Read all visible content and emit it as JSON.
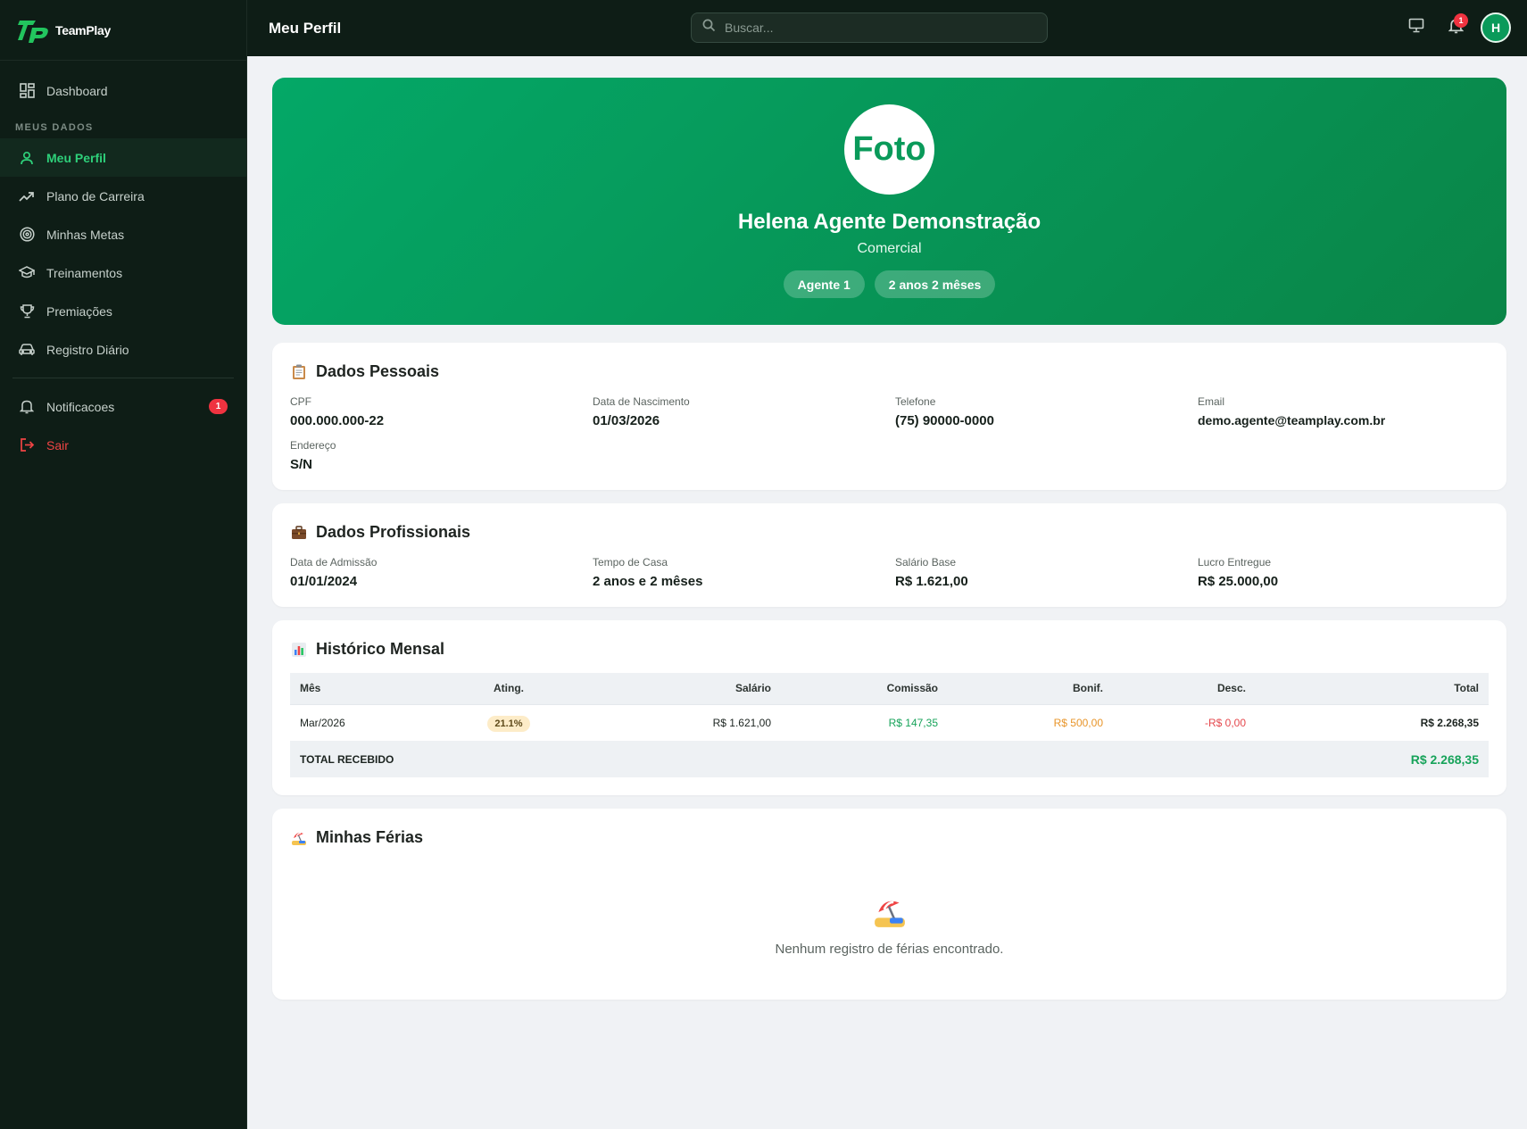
{
  "brand": {
    "name": "TeamPlay"
  },
  "sidebar": {
    "dashboard": "Dashboard",
    "section_label": "MEUS DADOS",
    "items": [
      {
        "label": "Meu Perfil",
        "icon": "user-icon",
        "active": true
      },
      {
        "label": "Plano de Carreira",
        "icon": "trending-up-icon"
      },
      {
        "label": "Minhas Metas",
        "icon": "target-icon"
      },
      {
        "label": "Treinamentos",
        "icon": "graduation-cap-icon"
      },
      {
        "label": "Premiações",
        "icon": "trophy-icon"
      },
      {
        "label": "Registro Diário",
        "icon": "car-icon"
      }
    ],
    "notifications": {
      "label": "Notificacoes",
      "badge": "1"
    },
    "logout": "Sair"
  },
  "topbar": {
    "title": "Meu Perfil",
    "search_placeholder": "Buscar...",
    "bell_badge": "1",
    "avatar_initial": "H"
  },
  "profile": {
    "photo_text": "Foto",
    "name": "Helena Agente Demonstração",
    "role": "Comercial",
    "level": "Agente 1",
    "tenure": "2 anos 2 mêses"
  },
  "personal": {
    "title": "Dados Pessoais",
    "cpf_label": "CPF",
    "cpf": "000.000.000-22",
    "birth_label": "Data de Nascimento",
    "birth": "01/03/2026",
    "phone_label": "Telefone",
    "phone": "(75) 90000-0000",
    "email_label": "Email",
    "email": "demo.agente@teamplay.com.br",
    "address_label": "Endereço",
    "address": "S/N"
  },
  "professional": {
    "title": "Dados Profissionais",
    "admission_label": "Data de Admissão",
    "admission": "01/01/2024",
    "tenure_label": "Tempo de Casa",
    "tenure": "2 anos e 2 mêses",
    "salary_label": "Salário Base",
    "salary": "R$ 1.621,00",
    "profit_label": "Lucro Entregue",
    "profit": "R$ 25.000,00"
  },
  "history": {
    "title": "Histórico Mensal",
    "columns": [
      "Mês",
      "Ating.",
      "Salário",
      "Comissão",
      "Bonif.",
      "Desc.",
      "Total"
    ],
    "rows": [
      {
        "month": "Mar/2026",
        "ating": "21.1%",
        "salary": "R$ 1.621,00",
        "commission": "R$ 147,35",
        "bonus": "R$ 500,00",
        "discount": "-R$ 0,00",
        "total": "R$ 2.268,35"
      }
    ],
    "total_label": "TOTAL RECEBIDO",
    "total_value": "R$ 2.268,35"
  },
  "vacation": {
    "title": "Minhas Férias",
    "empty_text": "Nenhum registro de férias encontrado."
  },
  "colors": {
    "accent": "#0a9a5a",
    "sidebar_bg": "#0e1d16",
    "active_text": "#2ed07a",
    "danger": "#ef4444"
  }
}
